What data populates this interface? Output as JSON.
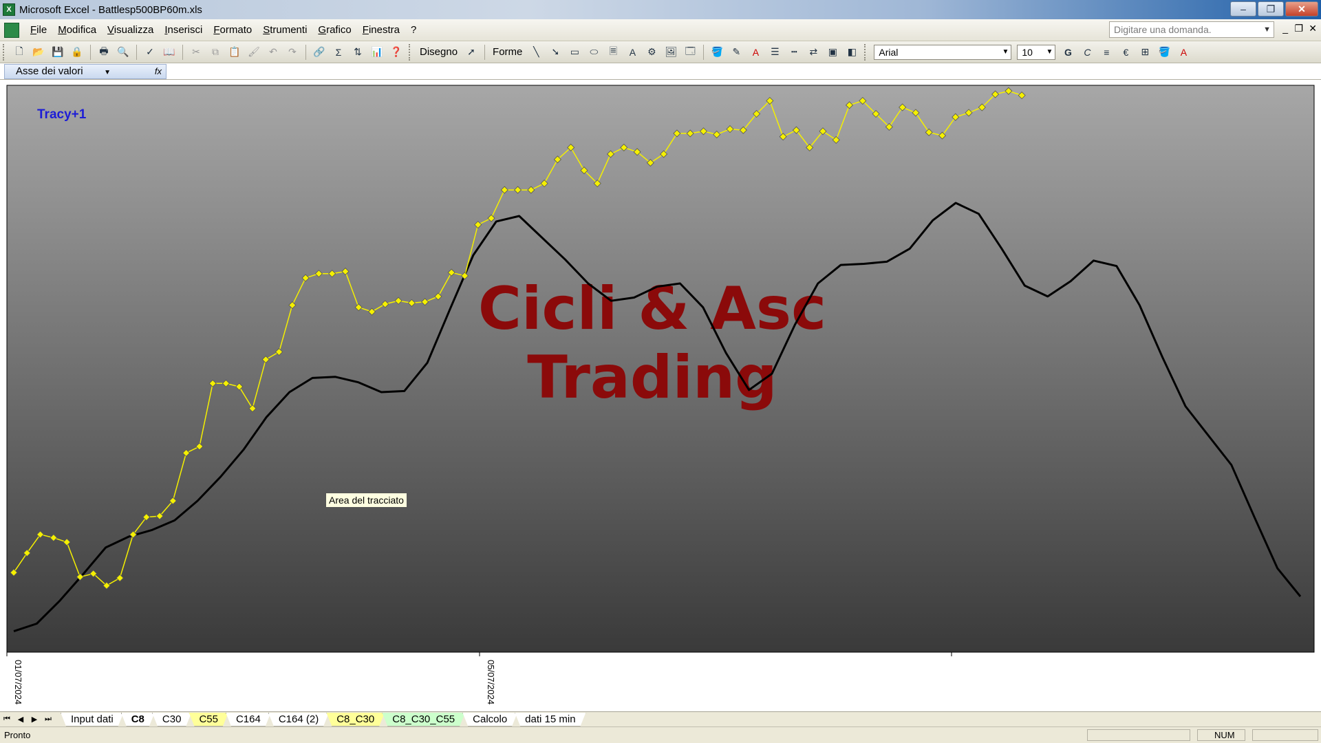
{
  "window": {
    "title": "Microsoft Excel - Battlesp500BP60m.xls",
    "controls": [
      "–",
      "❐",
      "✕"
    ]
  },
  "menu": {
    "items": [
      "File",
      "Modifica",
      "Visualizza",
      "Inserisci",
      "Formato",
      "Strumenti",
      "Grafico",
      "Finestra",
      "?"
    ],
    "ask_placeholder": "Digitare una domanda.",
    "doc_controls": [
      "_",
      "❐",
      "✕"
    ]
  },
  "toolbar": {
    "draw_label": "Disegno",
    "shapes_label": "Forme",
    "font_name": "Arial",
    "font_size": "10",
    "bold": "G",
    "italic": "C",
    "euro": "€"
  },
  "chart_selector": {
    "value": "Asse dei valori",
    "fx": "fx"
  },
  "chart": {
    "label_top_left": "Tracy+1",
    "watermark_line1": "Cicli & Asc",
    "watermark_line2": "Trading",
    "tooltip": "Area del tracciato",
    "colors": {
      "plot_top": "#a7a7a7",
      "plot_bottom": "#3a3a3a",
      "cycle_line": "#000000",
      "price_line": "#f5f000",
      "watermark": "#8b0a0a",
      "label": "#1d1dd6"
    }
  },
  "chart_data": {
    "type": "line",
    "x_ticks": [
      "01/07/2024",
      "05/07/2024"
    ],
    "series": [
      {
        "style": "smooth-black",
        "values": [
          -22,
          -15,
          6,
          30,
          55,
          65,
          71,
          80,
          98,
          120,
          145,
          175,
          198,
          211,
          212,
          207,
          198,
          199,
          225,
          275,
          324,
          355,
          360,
          340,
          320,
          298,
          282,
          285,
          295,
          298,
          276,
          234,
          200,
          215,
          260,
          298,
          315,
          316,
          318,
          330,
          356,
          372,
          362,
          330,
          296,
          286,
          300,
          319,
          314,
          278,
          230,
          185,
          158,
          131,
          83,
          36,
          10
        ]
      },
      {
        "style": "yellow-markers",
        "values": [
          32,
          50,
          67,
          64,
          60,
          28,
          31,
          20,
          27,
          67,
          83,
          84,
          98,
          142,
          148,
          206,
          206,
          203,
          183,
          228,
          235,
          278,
          303,
          307,
          307,
          309,
          276,
          272,
          279,
          282,
          280,
          281,
          286,
          308,
          305,
          352,
          358,
          384,
          384,
          384,
          390,
          412,
          423,
          402,
          390,
          417,
          423,
          419,
          409,
          417,
          436,
          436,
          438,
          435,
          440,
          439,
          454,
          466,
          433,
          439,
          423,
          438,
          430,
          462,
          466,
          454,
          442,
          460,
          455,
          437,
          434,
          451,
          455,
          460,
          472,
          475,
          471
        ]
      }
    ]
  },
  "sheet_tabs": {
    "nav": [
      "⏮",
      "◀",
      "▶",
      "⏭"
    ],
    "tabs": [
      {
        "label": "Input dati",
        "color": "#ffffff"
      },
      {
        "label": "C8",
        "color": "#ffffff"
      },
      {
        "label": "C30",
        "color": "#ffffff"
      },
      {
        "label": "C55",
        "color": "#ffff99"
      },
      {
        "label": "C164",
        "color": "#ffffff"
      },
      {
        "label": "C164 (2)",
        "color": "#ffffff"
      },
      {
        "label": "C8_C30",
        "color": "#ffff99"
      },
      {
        "label": "C8_C30_C55",
        "color": "#ccffcc"
      },
      {
        "label": "Calcolo",
        "color": "#ffffff"
      },
      {
        "label": "dati 15 min",
        "color": "#ffffff"
      }
    ],
    "active": "C8"
  },
  "status": {
    "text": "Pronto",
    "num": "NUM"
  }
}
